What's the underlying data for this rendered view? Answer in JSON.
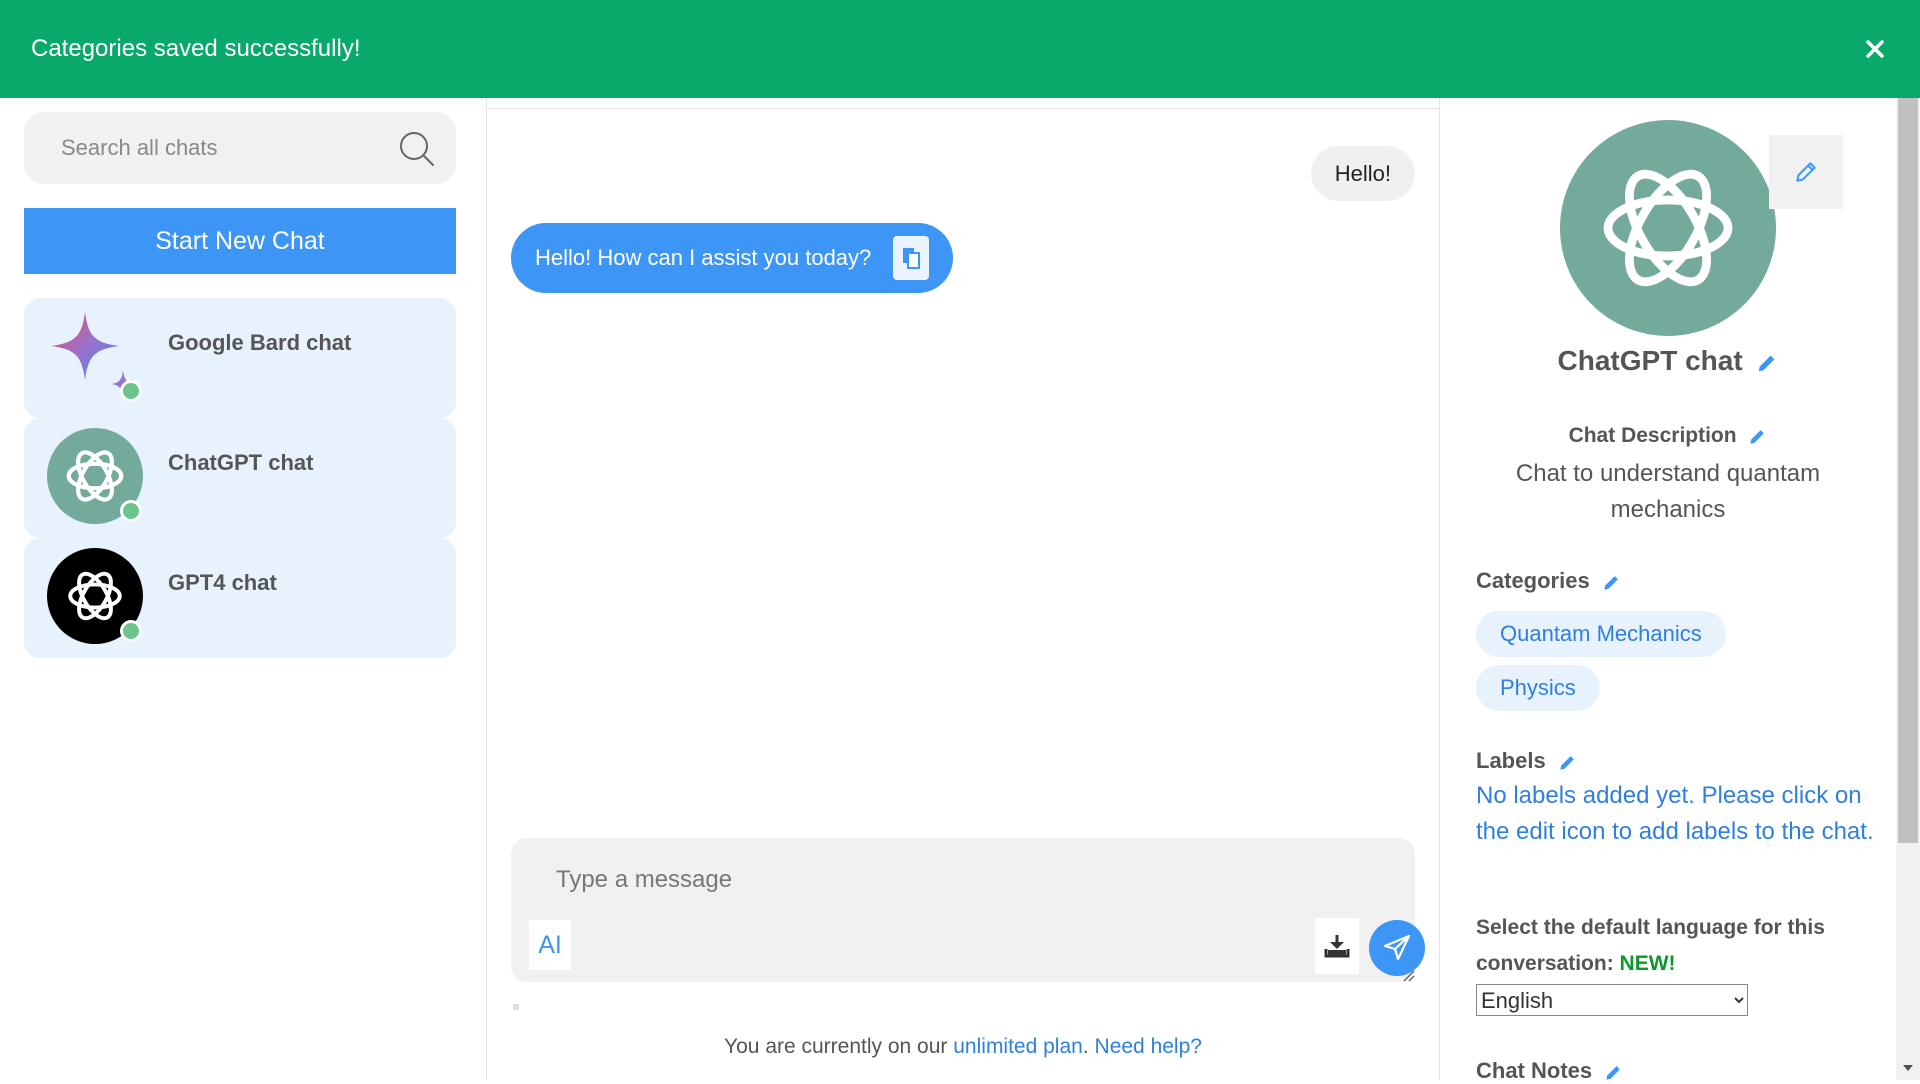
{
  "toast": {
    "message": "Categories saved successfully!"
  },
  "sidebar": {
    "search_placeholder": "Search all chats",
    "new_chat_label": "Start New Chat",
    "chats": [
      {
        "name": "Google Bard chat",
        "icon": "google-bard-icon"
      },
      {
        "name": "ChatGPT chat",
        "icon": "chatgpt-icon"
      },
      {
        "name": "GPT4 chat",
        "icon": "gpt4-icon"
      }
    ]
  },
  "conversation": {
    "messages": [
      {
        "role": "user",
        "text": "Hello!"
      },
      {
        "role": "assistant",
        "text": "Hello! How can I assist you today?"
      }
    ],
    "composer_placeholder": "Type a message",
    "ai_button_label": "AI",
    "plan": {
      "prefix": "You are currently on our ",
      "plan_link": "unlimited plan",
      "period": ".",
      "help_link": "Need help?"
    }
  },
  "details": {
    "title": "ChatGPT chat",
    "description_label": "Chat Description",
    "description": "Chat to understand quantam mechanics",
    "categories_label": "Categories",
    "categories": [
      "Quantam Mechanics",
      "Physics"
    ],
    "labels_label": "Labels",
    "labels_empty": "No labels added yet. Please click on the edit icon to add labels to the chat.",
    "language_label": "Select the default language for this conversation:",
    "language_new_badge": "NEW!",
    "language_selected": "English",
    "notes_label": "Chat Notes"
  },
  "colors": {
    "toast_bg": "#09a86b",
    "accent": "#3d95f5",
    "chatgpt_green": "#74aa9c",
    "online_dot": "#6cc48d"
  }
}
